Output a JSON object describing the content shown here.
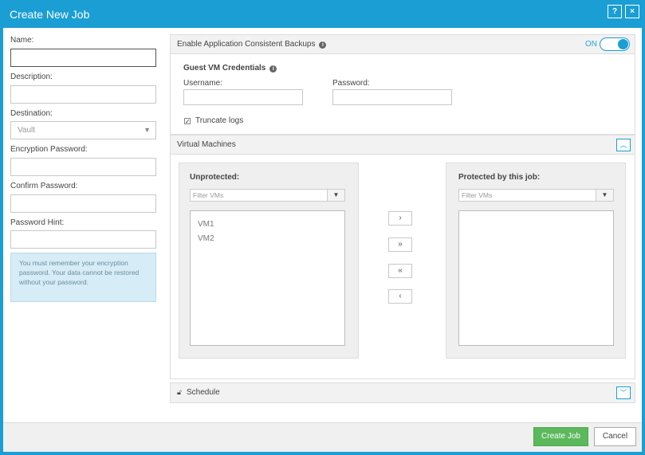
{
  "dialog": {
    "title": "Create New Job",
    "help_label": "?",
    "close_label": "×"
  },
  "form": {
    "name_label": "Name:",
    "description_label": "Description:",
    "destination_label": "Destination:",
    "destination_value": "Vault",
    "encryption_password_label": "Encryption Password:",
    "confirm_password_label": "Confirm Password:",
    "password_hint_label": "Password Hint:",
    "hint_text": "You must remember your encryption password. Your data cannot be restored without your password."
  },
  "app_consistent": {
    "header": "Enable Application Consistent Backups",
    "toggle_label": "ON",
    "credentials_title": "Guest VM Credentials",
    "username_label": "Username:",
    "password_label": "Password:",
    "truncate_label": "Truncate logs",
    "truncate_checked": true
  },
  "virtual_machines": {
    "header": "Virtual Machines",
    "unprotected_title": "Unprotected:",
    "protected_title": "Protected by this job:",
    "filter_placeholder": "Filter VMs",
    "unprotected_items": [
      "VM1",
      "VM2"
    ],
    "protected_items": [],
    "move_buttons": [
      "›",
      "»",
      "«",
      "‹"
    ]
  },
  "schedule": {
    "header": "Schedule"
  },
  "footer": {
    "create_label": "Create Job",
    "cancel_label": "Cancel"
  },
  "colors": {
    "accent": "#1a9ed4",
    "create_button": "#5cb85c",
    "hint_background": "#d6ecf6"
  }
}
